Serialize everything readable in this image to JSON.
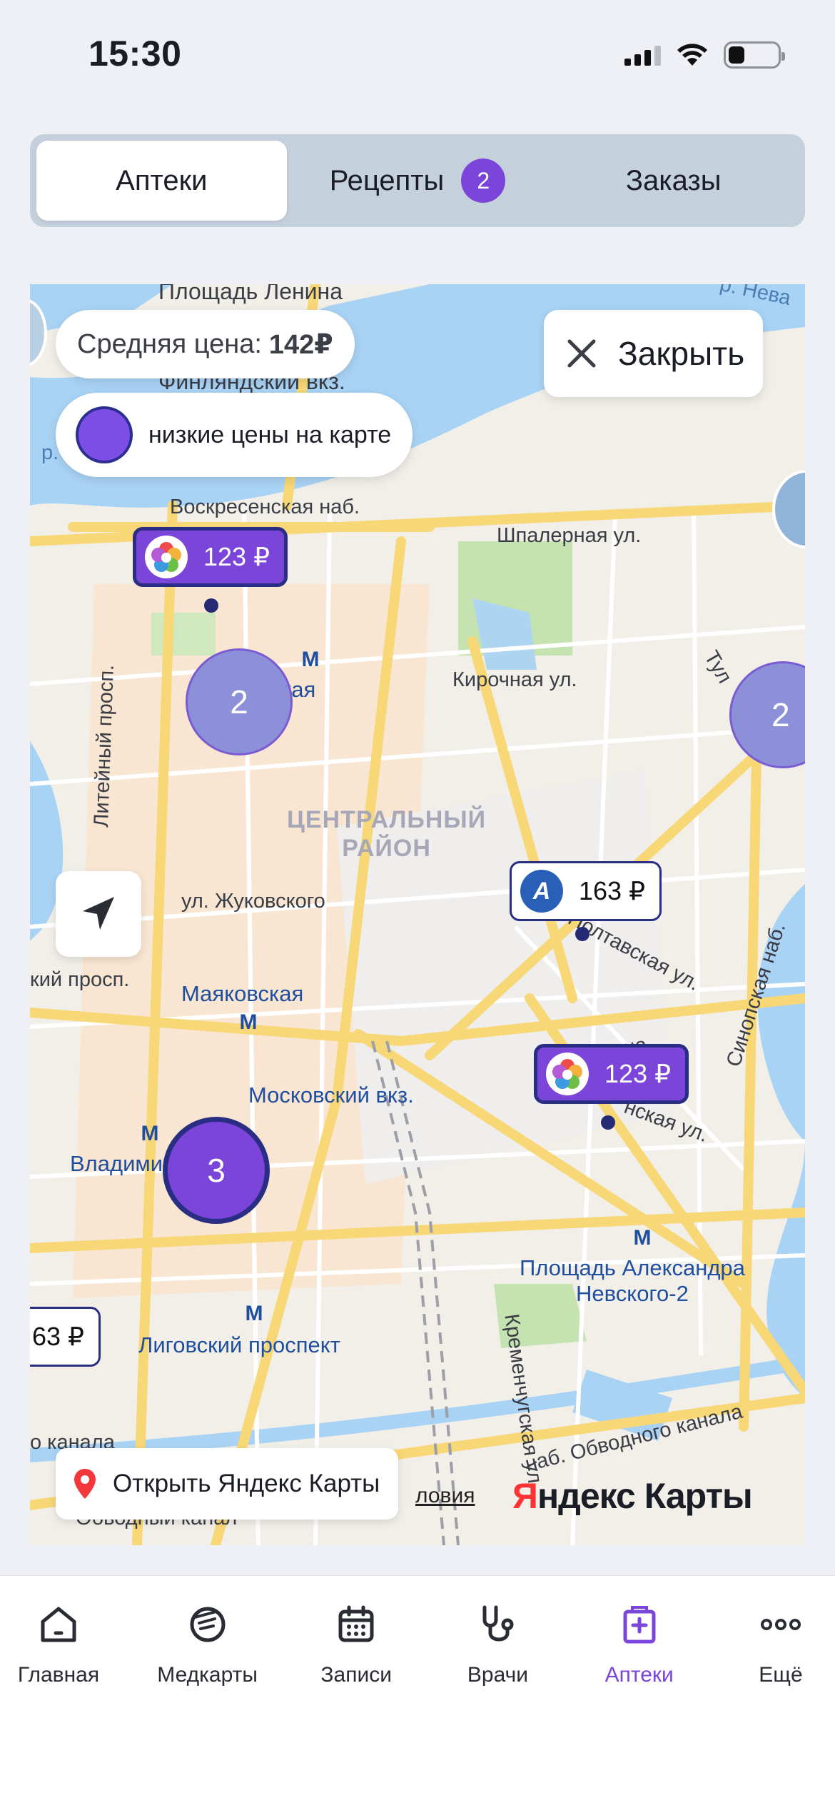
{
  "status_bar": {
    "time": "15:30"
  },
  "tabs": [
    {
      "label": "Аптеки",
      "active": true
    },
    {
      "label": "Рецепты",
      "badge": "2",
      "active": false
    },
    {
      "label": "Заказы",
      "active": false
    }
  ],
  "map": {
    "average_price_label": "Средняя цена:",
    "average_price_value": "142₽",
    "legend_text": "низкие цены на карте",
    "close_label": "Закрыть",
    "open_maps_label": "Открыть Яндекс Карты",
    "provider_logo_y": "Я",
    "provider_logo_rest": "ндекс Карты",
    "conditions_link": "ловия",
    "markers": [
      {
        "price": "123 ₽",
        "style": "low-price"
      },
      {
        "price": "163 ₽",
        "style": "regular"
      },
      {
        "price": "123 ₽",
        "style": "low-price"
      },
      {
        "price": "63 ₽",
        "style": "regular"
      }
    ],
    "clusters": [
      {
        "count": "2"
      },
      {
        "count": "2"
      },
      {
        "count": "3"
      }
    ],
    "labels": {
      "ploshchad_lenina": "Площадь Ленина",
      "finlyandsky": "Финляндский вкз.",
      "voskresenskaya": "Воскресенская наб.",
      "shpalernaya": "Шпалерная ул.",
      "chernyshevskaya": "ышевская",
      "kirochnaya": "Кирочная ул.",
      "liteyny": "Литейный просп.",
      "district": "ЦЕНТРАЛЬНЫЙ\nРАЙОН",
      "zhukovskogo": "ул. Жуковского",
      "mayakovskaya": "Маяковская",
      "moskovsky": "Московский вкз.",
      "vladimirskaya": "Владими",
      "ligovsky": "Лиговский проспект",
      "aleksandra": "Площадь Александра\nНевского-2",
      "kremenchugskaya": "Кременчугская ул.",
      "sinopskaya": "Синопская наб.",
      "obvodny": "наб. Обводного канала",
      "obvodny_canal": "Обводный канал",
      "neva": "р. Нева",
      "prosp": "кий просп.",
      "bakunina": "Бакунина",
      "tul": "Тул",
      "poltava": "Полтавская ул.",
      "goncharnaya": "нская ул.",
      "ykanala": "о канала",
      "r_left": "р."
    }
  },
  "nav": [
    {
      "label": "Главная",
      "icon": "home-icon",
      "active": false
    },
    {
      "label": "Медкарты",
      "icon": "medcard-icon",
      "active": false
    },
    {
      "label": "Записи",
      "icon": "calendar-icon",
      "active": false
    },
    {
      "label": "Врачи",
      "icon": "stethoscope-icon",
      "active": false
    },
    {
      "label": "Аптеки",
      "icon": "pharmacy-icon",
      "active": true
    },
    {
      "label": "Ещё",
      "icon": "more-icon",
      "active": false
    }
  ],
  "colors": {
    "accent": "#7b45d9",
    "marker_border": "#2a2d84",
    "river": "#a9d3f5",
    "road": "#f7d776"
  }
}
